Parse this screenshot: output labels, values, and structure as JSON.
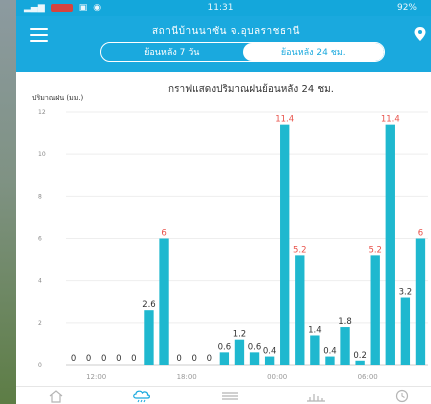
{
  "status_bar": {
    "time": "11:31",
    "battery": "92%"
  },
  "header": {
    "station_name": "สถานีบ้านนาซัน จ.อุบลราชธานี",
    "tabs": [
      {
        "label": "ย้อนหลัง 7 วัน",
        "active": false
      },
      {
        "label": "ย้อนหลัง 24 ชม.",
        "active": true
      }
    ]
  },
  "chart_data": {
    "type": "bar",
    "title": "กราฟแสดงปริมาณฝนย้อนหลัง 24 ชม.",
    "ylabel": "ปริมาณฝน (มม.)",
    "ylim": [
      0,
      12
    ],
    "yticks": [
      0,
      2,
      4,
      6,
      8,
      10,
      12
    ],
    "x_tick_labels": [
      "12:00",
      "18:00",
      "00:00",
      "06:00"
    ],
    "values": [
      0,
      0,
      0,
      0,
      0,
      2.6,
      6,
      0,
      0,
      0,
      0.6,
      1.2,
      0.6,
      0.4,
      11.4,
      5.2,
      1.4,
      0.4,
      1.8,
      0.2,
      5.2,
      11.4,
      3.2,
      6
    ],
    "labels": [
      "0",
      "0",
      "0",
      "0",
      "0",
      "2.6",
      "6",
      "0",
      "0",
      "0",
      "0.6",
      "1.2",
      "0.6",
      "0.4",
      "11.4",
      "5.2",
      "1.4",
      "0.4",
      "1.8",
      "0.2",
      "5.2",
      "11.4",
      "3.2",
      "6"
    ],
    "bar_color": "#1fb8cf",
    "label_colors": {
      "default": "#333333",
      "highlight": "#e8524a"
    },
    "highlight_values": [
      6,
      5.2,
      11.4
    ]
  },
  "bottom_nav": {
    "items": [
      {
        "icon": "home-icon",
        "active": false
      },
      {
        "icon": "rain-cloud-icon",
        "active": true
      },
      {
        "icon": "list-icon",
        "active": false
      },
      {
        "icon": "water-level-icon",
        "active": false
      },
      {
        "icon": "clock-icon",
        "active": false
      }
    ]
  },
  "colors": {
    "accent": "#1aa9de",
    "active_nav": "#1aa9de",
    "inactive_nav": "#b5b5b5"
  }
}
